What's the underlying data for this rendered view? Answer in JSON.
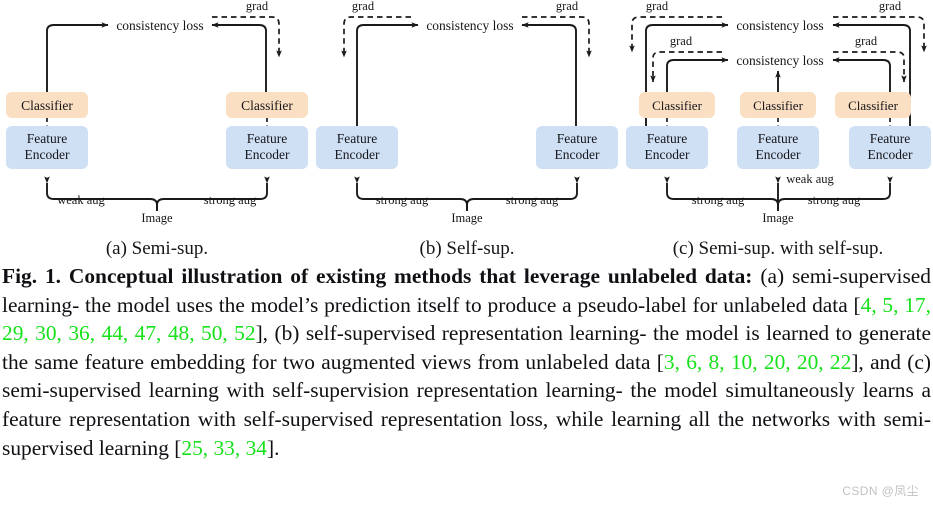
{
  "figure": {
    "colors": {
      "classifier_box": "#fbdfc3",
      "encoder_box": "#cfe0f5",
      "line": "#1a1a1a",
      "citation_green": "#16e11a"
    },
    "labels": {
      "classifier": "Classifier",
      "feature_encoder_line1": "Feature",
      "feature_encoder_line2": "Encoder",
      "consistency_loss": "consistency loss",
      "grad": "grad",
      "image": "Image",
      "weak_aug": "weak aug",
      "strong_aug": "strong aug"
    },
    "subcaptions": {
      "a": "(a) Semi-sup.",
      "b": "(b) Self-sup.",
      "c": "(c) Semi-sup. with self-sup."
    }
  },
  "caption": {
    "fig_label": "Fig. 1.",
    "bold_title": "Conceptual illustration of existing methods that leverage unlabeled data:",
    "body_1": " (a) semi-supervised learning- the model uses the model’s prediction itself to produce a pseudo-label for unlabeled data [",
    "cites_1": "4, 5, 17, 29, 30, 36, 44, 47, 48, 50, 52",
    "body_2": "], (b) self-supervised representation learning- the model is learned to generate the same feature embedding for two augmented views from unlabeled data [",
    "cites_2": "3, 6, 8, 10, 20, 20, 22",
    "body_3": "], and (c) semi-supervised learning with self-supervision representation learning- the model simultaneously learns a feature representation with self-supervised representation loss, while learning all the networks with semi-supervised learning [",
    "cites_3": "25, 33, 34",
    "body_4": "]."
  },
  "watermark": {
    "text": "CSDN @凤尘"
  }
}
